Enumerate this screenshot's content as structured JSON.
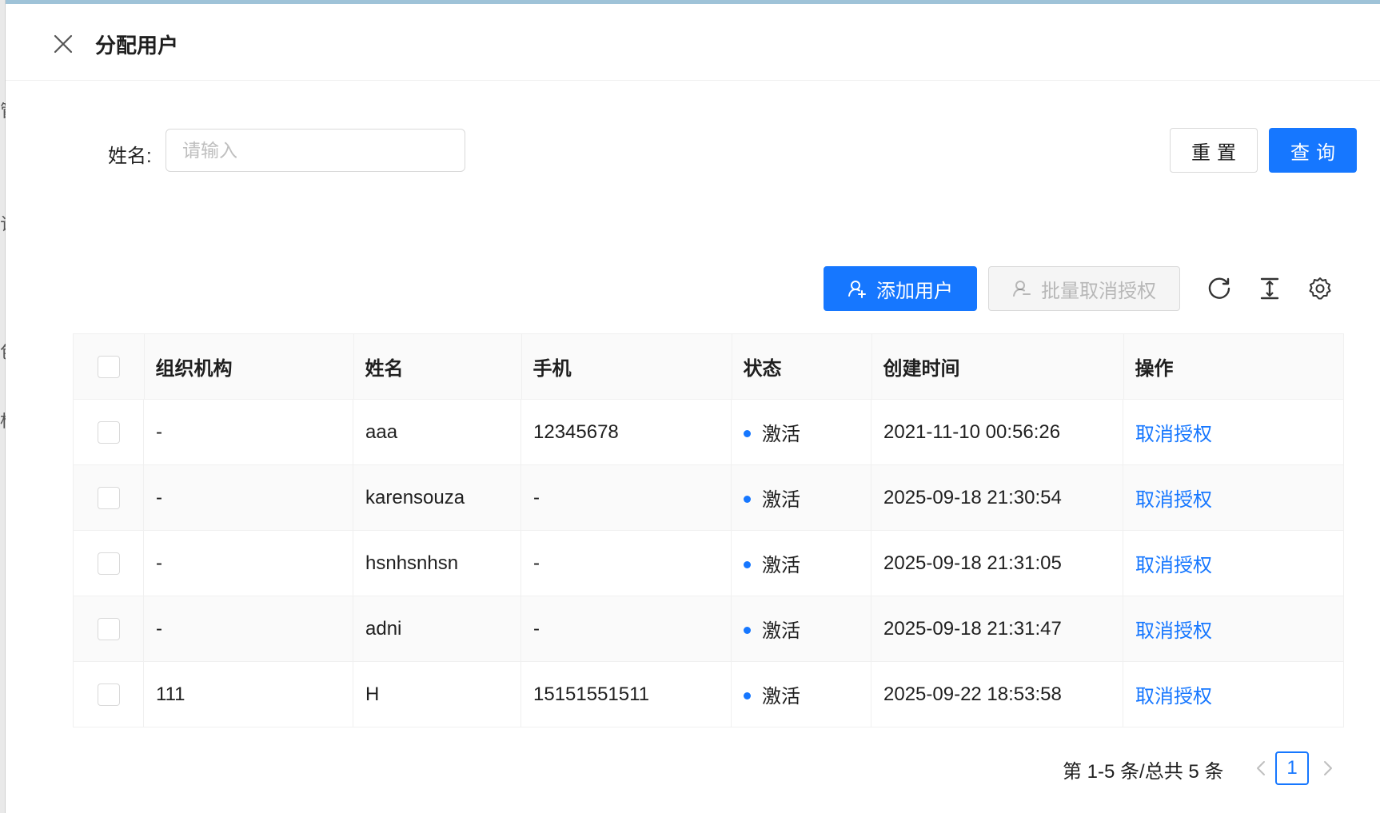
{
  "drawer": {
    "title": "分配用户"
  },
  "search": {
    "name_label": "姓名:",
    "name_placeholder": "请输入",
    "name_value": "",
    "reset_label": "重置",
    "query_label": "查询"
  },
  "toolbar": {
    "add_user_label": "添加用户",
    "batch_revoke_label": "批量取消授权",
    "icons": [
      "reload-icon",
      "column-height-icon",
      "setting-icon"
    ]
  },
  "table": {
    "columns": [
      "组织机构",
      "姓名",
      "手机",
      "状态",
      "创建时间",
      "操作"
    ],
    "rows": [
      {
        "org": "-",
        "name": "aaa",
        "phone": "12345678",
        "status": "激活",
        "created": "2021-11-10 00:56:26",
        "action": "取消授权"
      },
      {
        "org": "-",
        "name": "karensouza",
        "phone": "-",
        "status": "激活",
        "created": "2025-09-18 21:30:54",
        "action": "取消授权"
      },
      {
        "org": "-",
        "name": "hsnhsnhsn",
        "phone": "-",
        "status": "激活",
        "created": "2025-09-18 21:31:05",
        "action": "取消授权"
      },
      {
        "org": "-",
        "name": "adni",
        "phone": "-",
        "status": "激活",
        "created": "2025-09-18 21:31:47",
        "action": "取消授权"
      },
      {
        "org": "111",
        "name": "H",
        "phone": "15151551511",
        "status": "激活",
        "created": "2025-09-22 18:53:58",
        "action": "取消授权"
      }
    ]
  },
  "pagination": {
    "summary": "第 1-5 条/总共 5 条",
    "current_page": "1"
  },
  "colors": {
    "primary": "#1677ff",
    "status_active": "#1677ff"
  }
}
